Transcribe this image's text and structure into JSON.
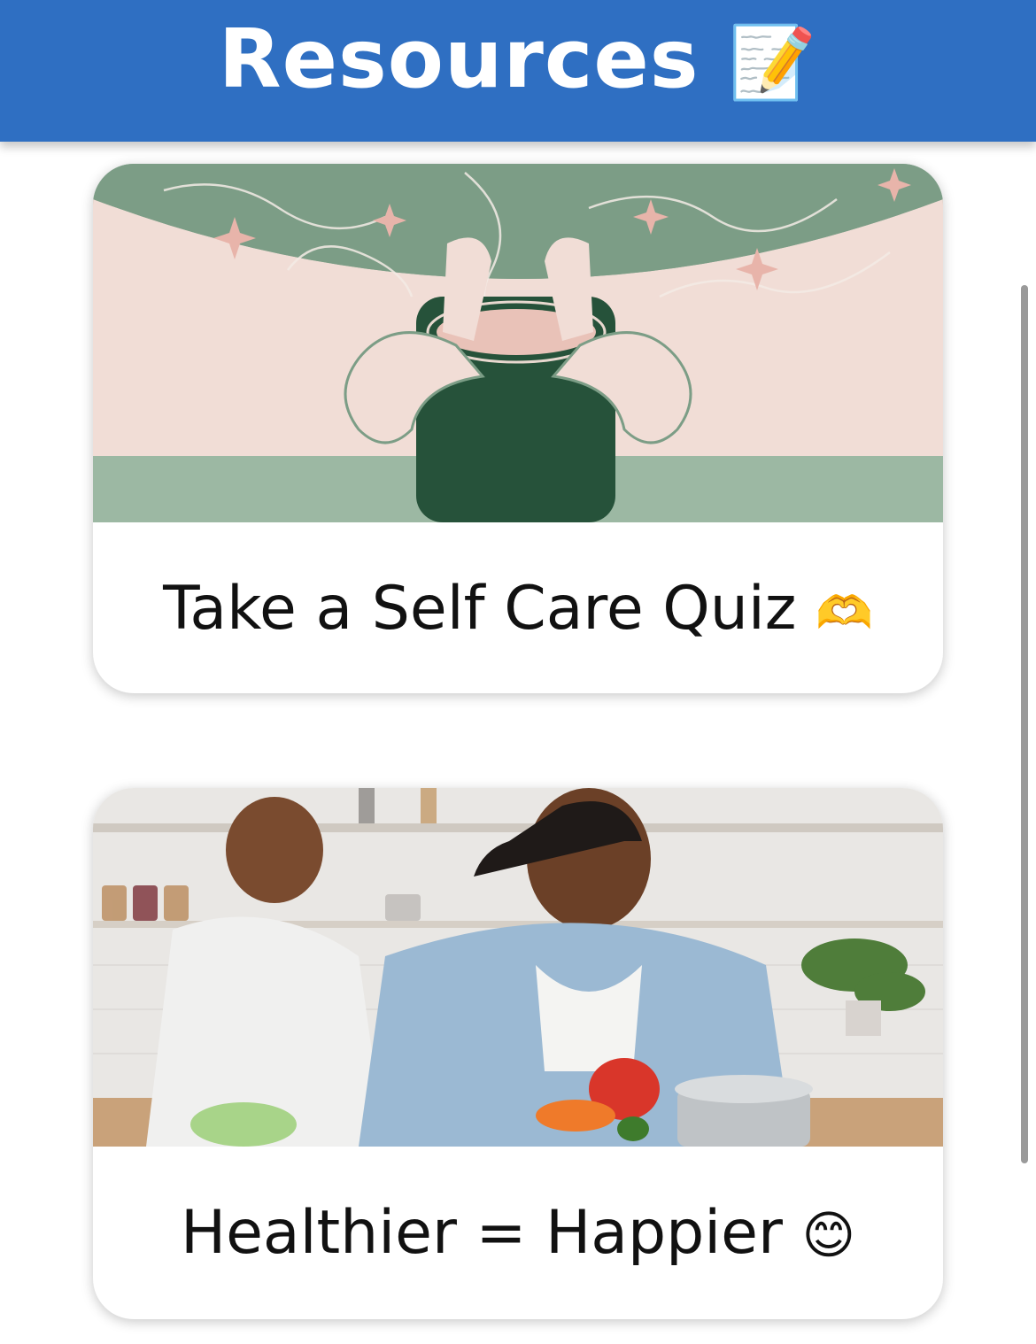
{
  "header": {
    "title": "Resources",
    "icon": "memo-icon",
    "icon_glyph": "📝"
  },
  "cards": [
    {
      "label": "Take a Self Care Quiz",
      "emoji": "🫶",
      "image": "hands-holding-mug-illustration"
    },
    {
      "label": "Healthier = Happier",
      "emoji": "😊",
      "image": "kitchen-family-photo"
    }
  ],
  "colors": {
    "header_bg": "#2f6fc2",
    "header_text": "#ffffff"
  }
}
